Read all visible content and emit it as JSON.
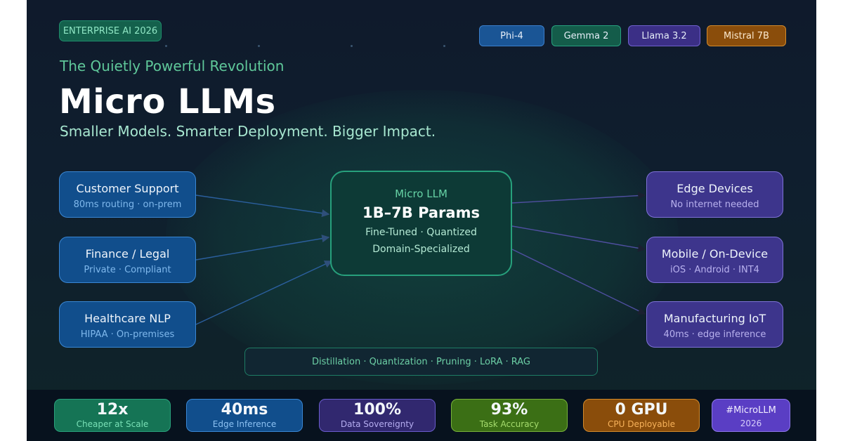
{
  "badge": "ENTERPRISE AI 2026",
  "model_pills": [
    "Phi-4",
    "Gemma 2",
    "Llama 3.2",
    "Mistral 7B"
  ],
  "kicker": "The Quietly Powerful Revolution",
  "title": "Micro LLMs",
  "subtitle": "Smaller Models. Smarter Deployment. Bigger Impact.",
  "left_boxes": [
    {
      "title": "Customer Support",
      "sub": "80ms routing · on-prem"
    },
    {
      "title": "Finance / Legal",
      "sub": "Private · Compliant"
    },
    {
      "title": "Healthcare NLP",
      "sub": "HIPAA · On-premises"
    }
  ],
  "center": {
    "label": "Micro LLM",
    "params": "1B–7B Params",
    "line1": "Fine-Tuned · Quantized",
    "line2": "Domain-Specialized"
  },
  "right_boxes": [
    {
      "title": "Edge Devices",
      "sub": "No internet needed"
    },
    {
      "title": "Mobile / On-Device",
      "sub": "iOS · Android · INT4"
    },
    {
      "title": "Manufacturing IoT",
      "sub": "40ms · edge inference"
    }
  ],
  "techniques": "Distillation · Quantization · Pruning · LoRA · RAG",
  "stats": [
    {
      "value": "12x",
      "label": "Cheaper at Scale"
    },
    {
      "value": "40ms",
      "label": "Edge Inference"
    },
    {
      "value": "100%",
      "label": "Data Sovereignty"
    },
    {
      "value": "93%",
      "label": "Task Accuracy"
    },
    {
      "value": "0 GPU",
      "label": "CPU Deployable"
    }
  ],
  "hashtag": "#MicroLLM",
  "year": "2026",
  "colors": {
    "background": "#0f1c2c",
    "accent_green": "#27a07c",
    "blue": "#114e8c",
    "purple": "#3d358c",
    "orange": "#8a4d0b"
  }
}
